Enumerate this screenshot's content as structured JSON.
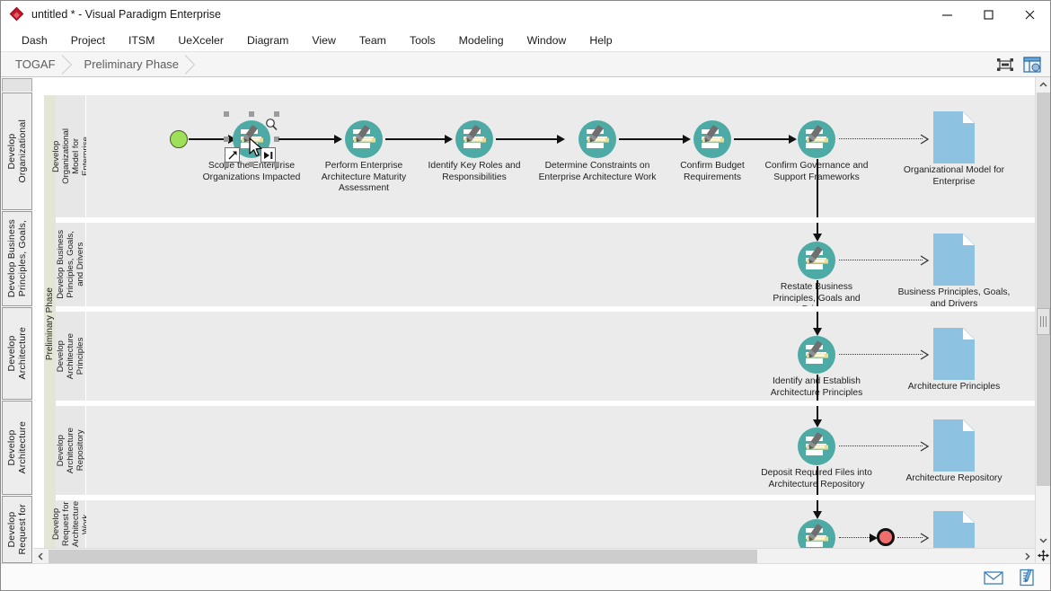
{
  "window": {
    "title": "untitled * - Visual Paradigm Enterprise",
    "logo_icon": "visual-paradigm-diamond-logo",
    "minimize_label": "—",
    "maximize_label": "□",
    "close_label": "✕"
  },
  "menubar": {
    "items": [
      {
        "label": "Dash"
      },
      {
        "label": "Project"
      },
      {
        "label": "ITSM"
      },
      {
        "label": "UeXceler"
      },
      {
        "label": "Diagram"
      },
      {
        "label": "View"
      },
      {
        "label": "Team"
      },
      {
        "label": "Tools"
      },
      {
        "label": "Modeling"
      },
      {
        "label": "Window"
      },
      {
        "label": "Help"
      }
    ]
  },
  "breadcrumb": {
    "crumbs": [
      {
        "label": "TOGAF"
      },
      {
        "label": "Preliminary Phase"
      }
    ],
    "tools": [
      {
        "icon": "fit-to-window-icon"
      },
      {
        "icon": "diagram-overview-icon"
      }
    ]
  },
  "left_tabs": [
    {
      "label": "Develop\nOrganizational"
    },
    {
      "label": "Develop Business\nPrinciples, Goals,"
    },
    {
      "label": "Develop\nArchitecture"
    },
    {
      "label": "Develop\nArchitecture"
    },
    {
      "label": "Develop\nRequest for"
    }
  ],
  "diagram": {
    "pool_label": "Preliminary Phase",
    "lanes": [
      {
        "label": "Develop\nOrganizational\nModel for\nEnterprise"
      },
      {
        "label": "Develop Business\nPrinciples, Goals,\nand Drivers"
      },
      {
        "label": "Develop\nArchitecture\nPrinciples"
      },
      {
        "label": "Develop\nArchitecture\nRepository"
      },
      {
        "label": "Develop\nRequest for\nArchitecture Work"
      }
    ],
    "start_event": {
      "name": "start-event"
    },
    "end_event": {
      "name": "end-event"
    },
    "tasks": [
      {
        "id": "t1",
        "label": "Scope the Enterprise\nOrganizations Impacted",
        "selected": true
      },
      {
        "id": "t2",
        "label": "Perform Enterprise\nArchitecture Maturity\nAssessment",
        "selected": false
      },
      {
        "id": "t3",
        "label": "Identify Key Roles and\nResponsibilities",
        "selected": false
      },
      {
        "id": "t4",
        "label": "Determine Constraints on\nEnterprise Architecture Work",
        "selected": false
      },
      {
        "id": "t5",
        "label": "Confirm Budget\nRequirements",
        "selected": false
      },
      {
        "id": "t6",
        "label": "Confirm Governance and\nSupport Frameworks",
        "selected": false
      },
      {
        "id": "t7",
        "label": "Restate Business\nPrinciples, Goals and\nDrivers",
        "selected": false
      },
      {
        "id": "t8",
        "label": "Identify and Establish\nArchitecture Principles",
        "selected": false
      },
      {
        "id": "t9",
        "label": "Deposit Required Files into\nArchitecture Repository",
        "selected": false
      },
      {
        "id": "t10",
        "label": "",
        "selected": false
      }
    ],
    "data_objects": [
      {
        "id": "d1",
        "label": "Organizational Model for\nEnterprise"
      },
      {
        "id": "d2",
        "label": "Business Principles, Goals,\nand Drivers"
      },
      {
        "id": "d3",
        "label": "Architecture Principles"
      },
      {
        "id": "d4",
        "label": "Architecture Repository"
      },
      {
        "id": "d5",
        "label": ""
      }
    ],
    "selection": {
      "magnifier_icon": "magnifier-icon",
      "resource_icons": [
        "create-connector-icon",
        "quick-action-icon",
        "open-sub-diagram-icon"
      ],
      "cursor_icon": "mouse-pointer-cursor"
    }
  },
  "colors": {
    "task_circle": "#4daaa5",
    "task_highlight": "#e8d98a",
    "data_object": "#8dc2e0",
    "start_event": "#9fe05a",
    "end_event": "#ef6d6d",
    "pool_header": "#e4e6d5",
    "lane_header": "#e7e7e7",
    "lane_body": "#ebebeb"
  },
  "scrollbars": {
    "vertical_up": "∧",
    "vertical_down": "∨",
    "horizontal_left": "‹",
    "horizontal_right": "›",
    "pan_icon": "pan-move-icon"
  },
  "statusbar": {
    "icons": [
      {
        "icon": "mail-icon"
      },
      {
        "icon": "note-edit-icon"
      }
    ]
  }
}
